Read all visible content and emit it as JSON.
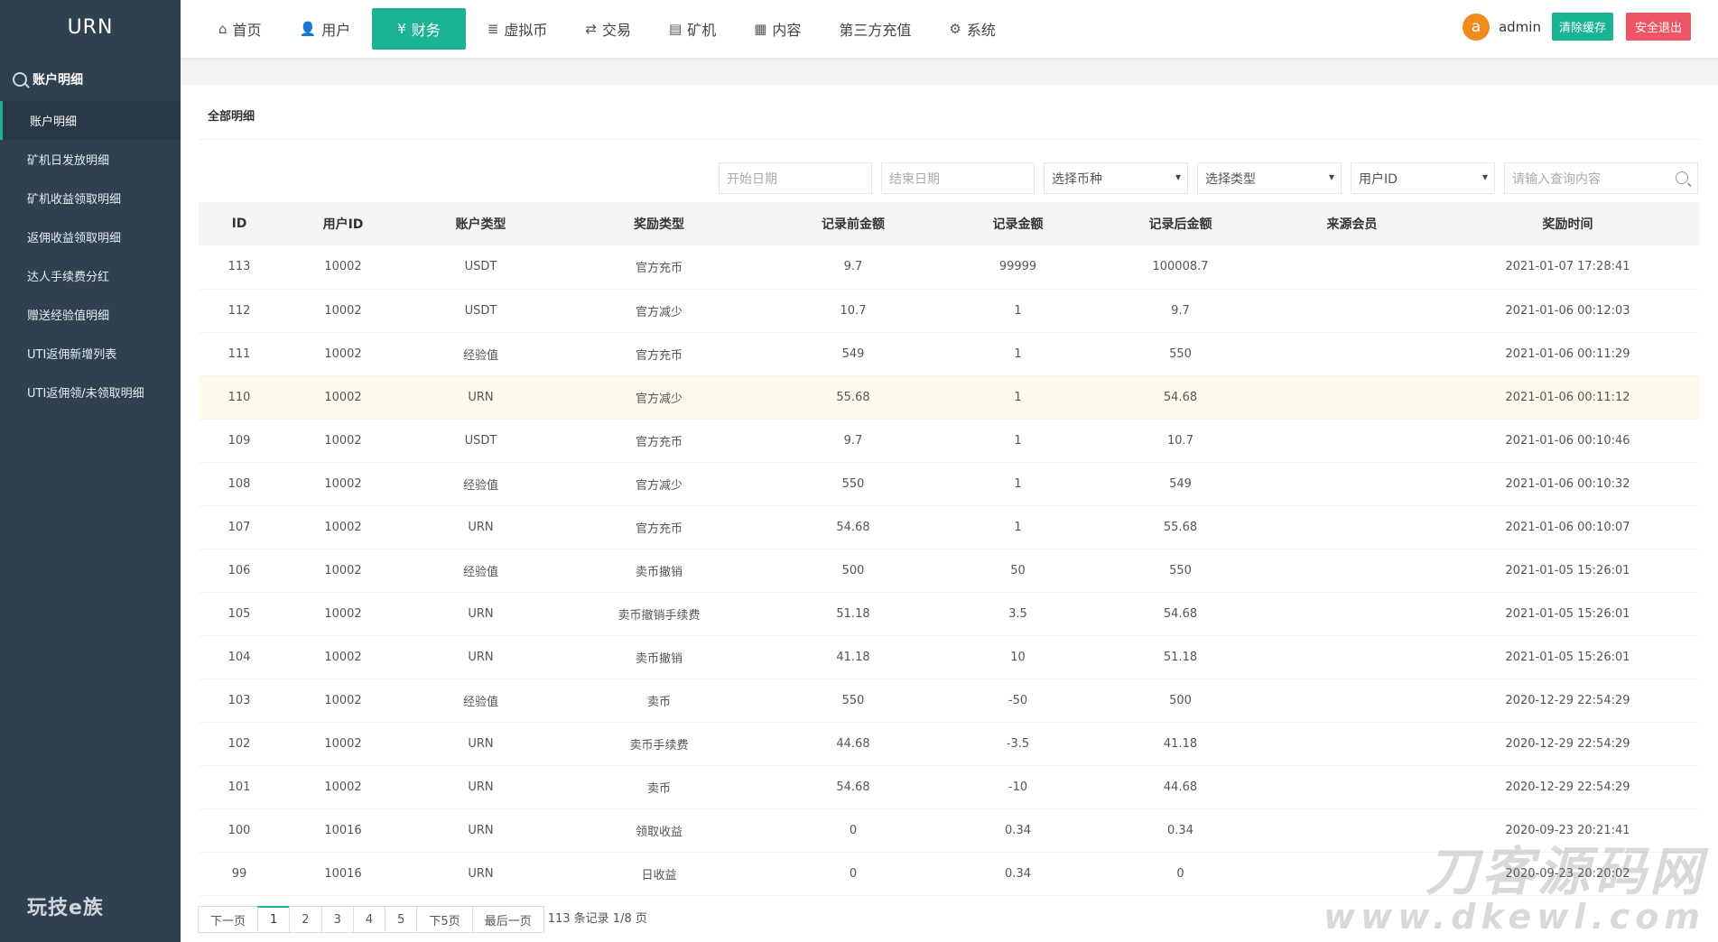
{
  "sidebar": {
    "logo": "URN",
    "header": "账户明细",
    "items": [
      {
        "label": "账户明细"
      },
      {
        "label": "矿机日发放明细"
      },
      {
        "label": "矿机收益领取明细"
      },
      {
        "label": "返佣收益领取明细"
      },
      {
        "label": "达人手续费分红"
      },
      {
        "label": "赠送经验值明细"
      },
      {
        "label": "UTI返佣新增列表"
      },
      {
        "label": "UTI返佣领/未领取明细"
      }
    ],
    "brand": "玩技e族"
  },
  "nav": {
    "items": [
      {
        "label": "首页",
        "icon": "home-icon"
      },
      {
        "label": "用户",
        "icon": "user-icon"
      },
      {
        "label": "财务",
        "icon": "finance-icon"
      },
      {
        "label": "虚拟币",
        "icon": "database-icon"
      },
      {
        "label": "交易",
        "icon": "exchange-icon"
      },
      {
        "label": "矿机",
        "icon": "server-icon"
      },
      {
        "label": "内容",
        "icon": "document-icon"
      },
      {
        "label": "第三方充值",
        "icon": ""
      },
      {
        "label": "系统",
        "icon": "gear-icon"
      }
    ],
    "active": "财务"
  },
  "user": {
    "avatar_letter": "a",
    "name": "admin",
    "clear_cache": "清除缓存",
    "logout": "安全退出"
  },
  "panel": {
    "title": "全部明细"
  },
  "filters": {
    "start_date_placeholder": "开始日期",
    "end_date_placeholder": "结束日期",
    "currency_select": "选择币种",
    "type_select": "选择类型",
    "user_id_select": "用户ID",
    "search_placeholder": "请输入查询内容"
  },
  "table": {
    "columns": [
      "ID",
      "用户ID",
      "账户类型",
      "奖励类型",
      "记录前金额",
      "记录金额",
      "记录后金额",
      "来源会员",
      "奖励时间"
    ],
    "rows": [
      [
        "113",
        "10002",
        "USDT",
        "官方充币",
        "9.7",
        "99999",
        "100008.7",
        "",
        "2021-01-07 17:28:41"
      ],
      [
        "112",
        "10002",
        "USDT",
        "官方减少",
        "10.7",
        "1",
        "9.7",
        "",
        "2021-01-06 00:12:03"
      ],
      [
        "111",
        "10002",
        "经验值",
        "官方充币",
        "549",
        "1",
        "550",
        "",
        "2021-01-06 00:11:29"
      ],
      [
        "110",
        "10002",
        "URN",
        "官方减少",
        "55.68",
        "1",
        "54.68",
        "",
        "2021-01-06 00:11:12"
      ],
      [
        "109",
        "10002",
        "USDT",
        "官方充币",
        "9.7",
        "1",
        "10.7",
        "",
        "2021-01-06 00:10:46"
      ],
      [
        "108",
        "10002",
        "经验值",
        "官方减少",
        "550",
        "1",
        "549",
        "",
        "2021-01-06 00:10:32"
      ],
      [
        "107",
        "10002",
        "URN",
        "官方充币",
        "54.68",
        "1",
        "55.68",
        "",
        "2021-01-06 00:10:07"
      ],
      [
        "106",
        "10002",
        "经验值",
        "卖币撤销",
        "500",
        "50",
        "550",
        "",
        "2021-01-05 15:26:01"
      ],
      [
        "105",
        "10002",
        "URN",
        "卖币撤销手续费",
        "51.18",
        "3.5",
        "54.68",
        "",
        "2021-01-05 15:26:01"
      ],
      [
        "104",
        "10002",
        "URN",
        "卖币撤销",
        "41.18",
        "10",
        "51.18",
        "",
        "2021-01-05 15:26:01"
      ],
      [
        "103",
        "10002",
        "经验值",
        "卖币",
        "550",
        "-50",
        "500",
        "",
        "2020-12-29 22:54:29"
      ],
      [
        "102",
        "10002",
        "URN",
        "卖币手续费",
        "44.68",
        "-3.5",
        "41.18",
        "",
        "2020-12-29 22:54:29"
      ],
      [
        "101",
        "10002",
        "URN",
        "卖币",
        "54.68",
        "-10",
        "44.68",
        "",
        "2020-12-29 22:54:29"
      ],
      [
        "100",
        "10016",
        "URN",
        "领取收益",
        "0",
        "0.34",
        "0.34",
        "",
        "2020-09-23 20:21:41"
      ],
      [
        "99",
        "10016",
        "URN",
        "日收益",
        "0",
        "0.34",
        "0",
        "",
        "2020-09-23 20:20:02"
      ]
    ],
    "highlighted_row": 3
  },
  "pagination": {
    "prev": "下一页",
    "pages": [
      "1",
      "2",
      "3",
      "4",
      "5"
    ],
    "current": "1",
    "next5": "下5页",
    "last": "最后一页",
    "info": "113 条记录 1/8 页"
  },
  "watermark": {
    "line1": "刀客源码网",
    "line2": "www.dkewl.com"
  },
  "colors": {
    "sidebar_bg": "#2f4050",
    "accent": "#1ab394",
    "danger": "#ed5565",
    "avatar": "#f08c1e"
  }
}
